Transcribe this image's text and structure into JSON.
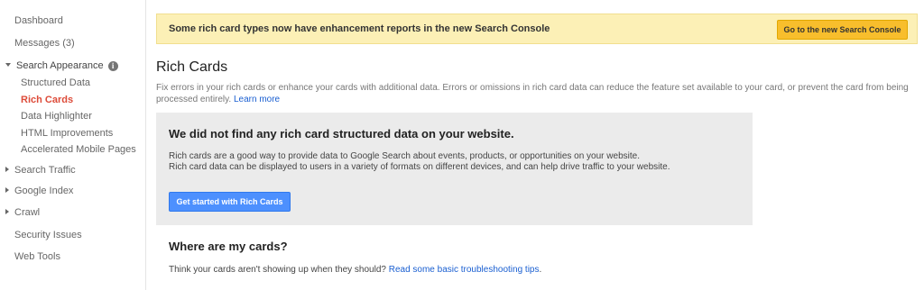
{
  "sidebar": {
    "dashboard": "Dashboard",
    "messages": "Messages (3)",
    "search_appearance": "Search Appearance",
    "search_appearance_items": [
      "Structured Data",
      "Rich Cards",
      "Data Highlighter",
      "HTML Improvements",
      "Accelerated Mobile Pages"
    ],
    "search_traffic": "Search Traffic",
    "google_index": "Google Index",
    "crawl": "Crawl",
    "security_issues": "Security Issues",
    "web_tools": "Web Tools",
    "info_icon": "i"
  },
  "banner": {
    "text": "Some rich card types now have enhancement reports in the new Search Console",
    "button": "Go to the new Search Console"
  },
  "main": {
    "title": "Rich Cards",
    "description": "Fix errors in your rich cards or enhance your cards with additional data. Errors or omissions in rich card data can reduce the feature set available to your card, or prevent the card from being processed entirely.",
    "learn_more": "Learn more",
    "panel": {
      "title": "We did not find any rich card structured data on your website.",
      "text_line1": "Rich cards are a good way to provide data to Google Search about events, products, or opportunities on your website.",
      "text_line2": "Rich card data can be displayed to users in a variety of formats on different devices, and can help drive traffic to your website.",
      "button": "Get started with Rich Cards"
    },
    "where": {
      "title": "Where are my cards?",
      "text": "Think your cards aren't showing up when they should?",
      "link": "Read some basic troubleshooting tips"
    }
  },
  "colors": {
    "active_nav": "#dd4b39",
    "banner_bg": "#fcf0b6",
    "banner_button": "#f8be2c",
    "primary_button": "#4d90fe",
    "link": "#1a5fd1"
  }
}
